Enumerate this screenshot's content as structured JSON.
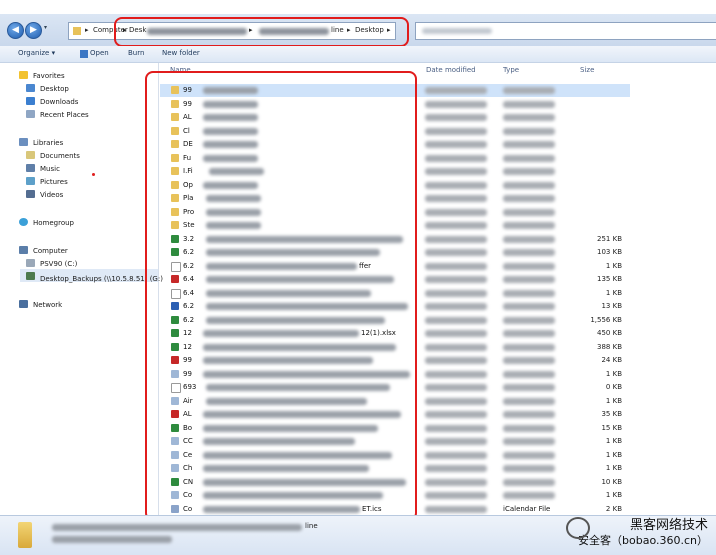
{
  "navigation": {
    "back_label": "◀",
    "forward_label": "▶",
    "breadcrumb": [
      "Computer",
      "Desk",
      "Desktop"
    ],
    "breadcrumb_partial": "line"
  },
  "toolbar": {
    "organize_label": "Organize ▾",
    "open_label": "Open",
    "burn_label": "Burn",
    "new_folder_label": "New folder"
  },
  "sidebar": {
    "favorites_label": "Favorites",
    "favorites": [
      "Desktop",
      "Downloads",
      "Recent Places"
    ],
    "libraries_label": "Libraries",
    "libraries": [
      "Documents",
      "Music",
      "Pictures",
      "Videos"
    ],
    "homegroup_label": "Homegroup",
    "computer_label": "Computer",
    "drives": [
      "PSV90 (C:)",
      "Desktop_Backups (\\\\10.5.8.51) (G:)"
    ],
    "network_label": "Network"
  },
  "columns": {
    "name": "Name",
    "date": "Date modified",
    "type": "Type",
    "size": "Size"
  },
  "files": [
    {
      "name": "99",
      "size": "",
      "icon": "folder",
      "sel": true
    },
    {
      "name": "99",
      "size": "",
      "icon": "folder"
    },
    {
      "name": "AL",
      "size": "",
      "icon": "folder"
    },
    {
      "name": "Cl",
      "size": "",
      "icon": "folder"
    },
    {
      "name": "DE",
      "size": "",
      "icon": "folder"
    },
    {
      "name": "Fu",
      "size": "",
      "icon": "folder"
    },
    {
      "name": "I.Fi",
      "size": "",
      "icon": "folder"
    },
    {
      "name": "Op",
      "size": "",
      "icon": "folder"
    },
    {
      "name": "Pla",
      "size": "",
      "icon": "folder"
    },
    {
      "name": "Pro",
      "size": "",
      "icon": "folder"
    },
    {
      "name": "Ste",
      "size": "",
      "icon": "folder"
    },
    {
      "name": "3.2",
      "size": "251 KB",
      "icon": "excel"
    },
    {
      "name": "6.2",
      "size": "103 KB",
      "icon": "excel"
    },
    {
      "name": "6.2",
      "size": "1 KB",
      "icon": "text",
      "tail": "ffer"
    },
    {
      "name": "6.4",
      "size": "135 KB",
      "icon": "pdf"
    },
    {
      "name": "6.4",
      "size": "1 KB",
      "icon": "text"
    },
    {
      "name": "6.2",
      "size": "13 KB",
      "icon": "word"
    },
    {
      "name": "6.2",
      "size": "1,556 KB",
      "icon": "excel"
    },
    {
      "name": "12",
      "size": "450 KB",
      "icon": "excel",
      "tail": "12(1).xlsx"
    },
    {
      "name": "12",
      "size": "388 KB",
      "icon": "excel"
    },
    {
      "name": "99",
      "size": "24 KB",
      "icon": "pdf"
    },
    {
      "name": "99",
      "size": "1 KB",
      "icon": "shortcut"
    },
    {
      "name": "693",
      "size": "0 KB",
      "icon": "text"
    },
    {
      "name": "Air",
      "size": "1 KB",
      "icon": "shortcut"
    },
    {
      "name": "AL",
      "size": "35 KB",
      "icon": "pdf"
    },
    {
      "name": "Bo",
      "size": "15 KB",
      "icon": "excel"
    },
    {
      "name": "CC",
      "size": "1 KB",
      "icon": "shortcut"
    },
    {
      "name": "Ce",
      "size": "1 KB",
      "icon": "shortcut"
    },
    {
      "name": "Ch",
      "size": "1 KB",
      "icon": "shortcut"
    },
    {
      "name": "CN",
      "size": "10 KB",
      "icon": "excel"
    },
    {
      "name": "Co",
      "size": "1 KB",
      "icon": "shortcut"
    },
    {
      "name": "Co",
      "size": "2 KB",
      "icon": "calendar",
      "tail": "ET.ics"
    }
  ],
  "calendar_file_type": "iCalendar File",
  "status_partial": "line",
  "watermark": {
    "line1": "黑客网络技术",
    "line2": "安全客（bobao.360.cn）"
  },
  "colors": {
    "folder": "#e8c25a",
    "excel": "#2e8b3e",
    "pdf": "#c62828",
    "word": "#2b5fb3",
    "text": "#ffffff",
    "shortcut": "#9fb7d6",
    "calendar": "#8aa3c9",
    "highlight": "#e11c1c"
  }
}
